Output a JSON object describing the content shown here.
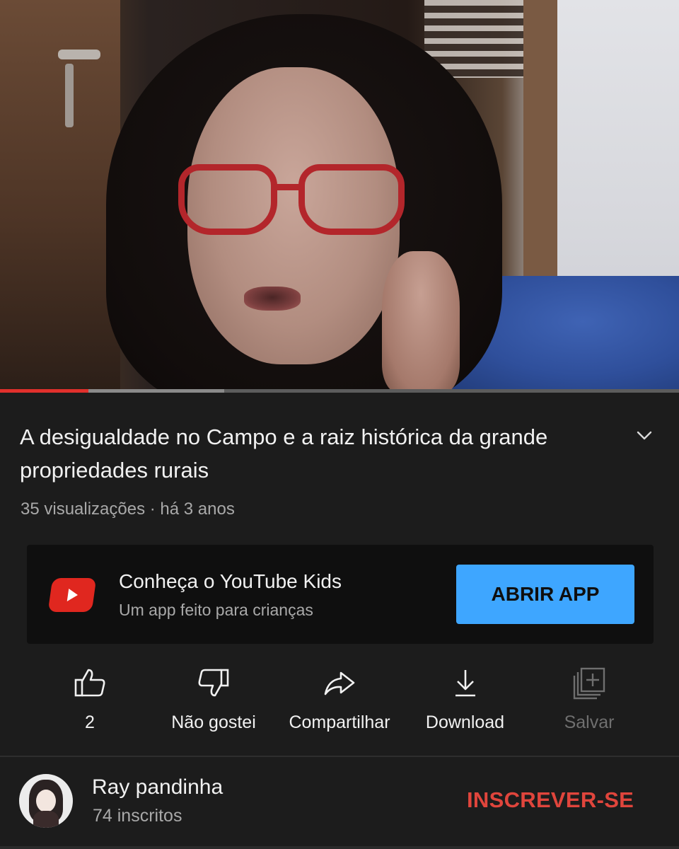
{
  "video": {
    "progress_played": 0.13,
    "progress_buffered": 0.33
  },
  "title": "A desigualdade no Campo e a raiz histórica da grande propriedades rurais",
  "meta": "35 visualizações · há 3 anos",
  "kids_promo": {
    "title": "Conheça o YouTube Kids",
    "subtitle": "Um app feito para crianças",
    "button": "ABRIR APP",
    "icon": "youtube-kids-logo-icon",
    "accent": "#3ea6ff",
    "logo_color": "#e0271f"
  },
  "actions": {
    "like": {
      "label": "2",
      "icon": "thumbs-up-icon"
    },
    "dislike": {
      "label": "Não gostei",
      "icon": "thumbs-down-icon"
    },
    "share": {
      "label": "Compartilhar",
      "icon": "share-arrow-icon"
    },
    "download": {
      "label": "Download",
      "icon": "download-icon"
    },
    "save": {
      "label": "Salvar",
      "icon": "add-to-playlist-icon"
    }
  },
  "channel": {
    "name": "Ray pandinha",
    "subscribers": "74 inscritos",
    "subscribe_label": "INSCREVER-SE",
    "subscribe_color": "#e0453c"
  },
  "colors": {
    "background": "#1c1c1c",
    "progress_red": "#e1302c"
  }
}
